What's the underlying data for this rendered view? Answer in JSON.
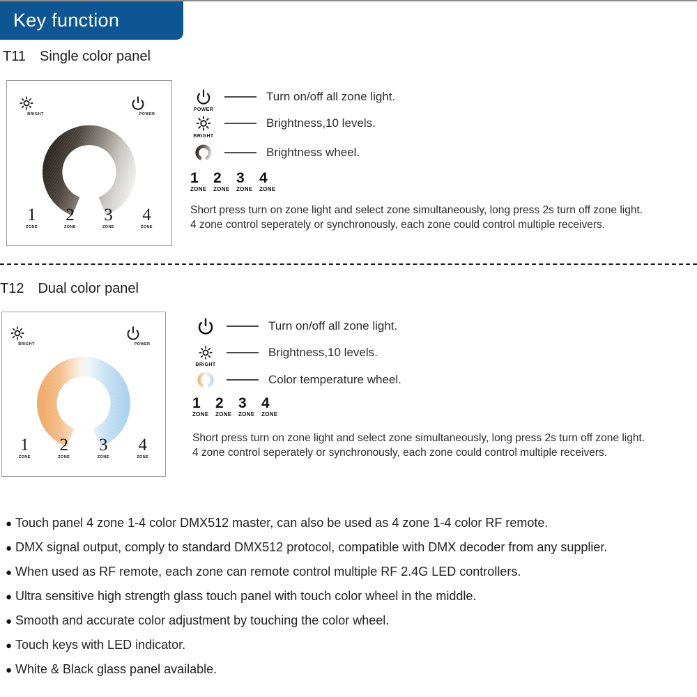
{
  "header": {
    "title": "Key function"
  },
  "sections": [
    {
      "code": "T11",
      "name": "Single color panel",
      "panel": {
        "bright_label": "BRIGHT",
        "power_label": "POWER",
        "bright_icon": "sun-icon",
        "power_icon": "power-icon",
        "wheel_icon": "brightness-wheel",
        "zones": [
          {
            "num": "1",
            "cap": "ZONE"
          },
          {
            "num": "2",
            "cap": "ZONE"
          },
          {
            "num": "3",
            "cap": "ZONE"
          },
          {
            "num": "4",
            "cap": "ZONE"
          }
        ]
      },
      "legend": [
        {
          "icon": "power-icon",
          "cap": "POWER",
          "text": "Turn on/off all zone light."
        },
        {
          "icon": "sun-icon",
          "cap": "BRIGHT",
          "text": "Brightness,10 levels."
        },
        {
          "icon": "brightness-wheel-icon",
          "cap": "",
          "text": "Brightness wheel."
        }
      ],
      "legend_zones": [
        {
          "num": "1",
          "cap": "ZONE"
        },
        {
          "num": "2",
          "cap": "ZONE"
        },
        {
          "num": "3",
          "cap": "ZONE"
        },
        {
          "num": "4",
          "cap": "ZONE"
        }
      ],
      "description_line1": "Short press turn on zone light and select zone simultaneously, long press 2s turn off zone light.",
      "description_line2": "4 zone control seperately or synchronously, each zone could control multiple receivers."
    },
    {
      "code": "T12",
      "name": "Dual color panel",
      "panel": {
        "bright_label": "BRIGHT",
        "power_label": "POWER",
        "bright_icon": "sun-icon",
        "power_icon": "power-icon",
        "wheel_icon": "color-temperature-wheel",
        "zones": [
          {
            "num": "1",
            "cap": "ZONE"
          },
          {
            "num": "2",
            "cap": "ZONE"
          },
          {
            "num": "3",
            "cap": "ZONE"
          },
          {
            "num": "4",
            "cap": "ZONE"
          }
        ]
      },
      "legend": [
        {
          "icon": "power-icon",
          "cap": "",
          "text": "Turn on/off all zone light."
        },
        {
          "icon": "sun-icon",
          "cap": "BRIGHT",
          "text": "Brightness,10 levels."
        },
        {
          "icon": "color-temperature-wheel-icon",
          "cap": "",
          "text": "Color temperature wheel."
        }
      ],
      "legend_zones": [
        {
          "num": "1",
          "cap": "ZONE"
        },
        {
          "num": "2",
          "cap": "ZONE"
        },
        {
          "num": "3",
          "cap": "ZONE"
        },
        {
          "num": "4",
          "cap": "ZONE"
        }
      ],
      "description_line1": "Short press turn on zone light and select zone simultaneously, long press 2s turn off zone light.",
      "description_line2": "4 zone control seperately or synchronously, each zone could control multiple receivers."
    }
  ],
  "features": {
    "bullet_marker": "●",
    "items": [
      "Touch panel 4 zone 1-4 color DMX512 master, can also be used as 4 zone 1-4 color RF remote.",
      "DMX signal output, comply to standard DMX512 protocol, compatible with DMX decoder from any supplier.",
      "When used as RF remote, each zone can remote control multiple RF 2.4G LED controllers.",
      "Ultra sensitive high strength glass touch panel with touch color wheel in the middle.",
      "Smooth and accurate color adjustment by touching the color wheel.",
      "Touch keys with LED indicator.",
      "White & Black glass panel available."
    ]
  },
  "colors": {
    "banner_blue": "#0d5693",
    "panel_border": "#9b9b9b",
    "text": "#1a1a1a",
    "wheel_dark": "#2b2520",
    "wheel_light": "#f2f2f2",
    "wheel_warm": "#f0a860",
    "wheel_cool": "#a9d4ef"
  }
}
